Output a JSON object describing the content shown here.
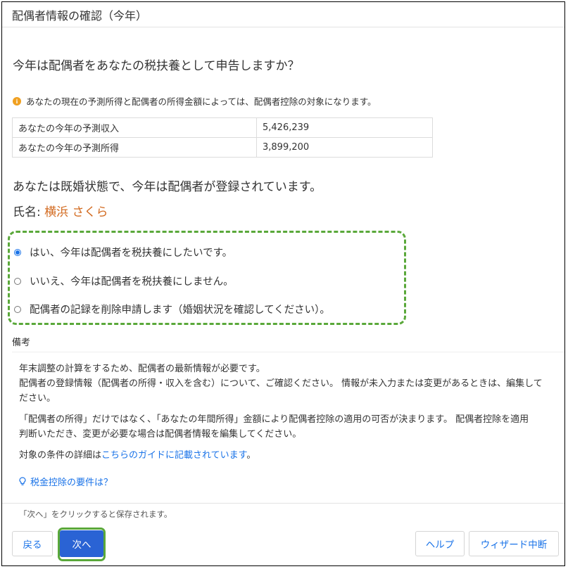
{
  "header": {
    "title": "配偶者情報の確認（今年）"
  },
  "question": "今年は配偶者をあなたの税扶養として申告しますか？",
  "info_text": "あなたの現在の予測所得と配偶者の所得金額によっては、配偶者控除の対象になります。",
  "income_table": [
    {
      "label": "あなたの今年の予測収入",
      "value": "5,426,239"
    },
    {
      "label": "あなたの今年の予測所得",
      "value": "3,899,200"
    }
  ],
  "married_text": "あなたは既婚状態で、今年は配偶者が登録されています。",
  "spouse": {
    "label": "氏名:",
    "name": "横浜 さくら"
  },
  "options": [
    {
      "label": "はい、今年は配偶者を税扶養にしたいです。",
      "checked": true
    },
    {
      "label": "いいえ、今年は配偶者を税扶養にしません。",
      "checked": false
    },
    {
      "label": "配偶者の記録を削除申請します（婚姻状況を確認してください）。",
      "checked": false
    }
  ],
  "remarks": {
    "label": "備考",
    "line1": "年末調整の計算をするため、配偶者の最新情報が必要です。",
    "line2": "配偶者の登録情報（配偶者の所得・収入を含む）について、ご確認ください。 情報が未入力または変更があるときは、編集して",
    "line3": "ださい。",
    "line4": "「配偶者の所得」だけではなく、「あなたの年間所得」金額により配偶者控除の適用の可否が決まります。 配偶者控除を適用",
    "line5": "判断いただき、変更が必要な場合は配偶者情報を編集してください。",
    "guide_prefix": "対象の条件の詳細は",
    "guide_link": "こちらのガイドに記載されています",
    "guide_suffix": "。"
  },
  "tip_link": "税金控除の要件は？",
  "footer": {
    "save_note": "「次へ」をクリックすると保存されます。",
    "back": "戻る",
    "next": "次へ",
    "help": "ヘルプ",
    "abort": "ウィザード中断"
  },
  "colors": {
    "accent": "#2a63d4",
    "highlight": "#5aa83a",
    "name": "#d2691e",
    "info": "#f0a020"
  }
}
